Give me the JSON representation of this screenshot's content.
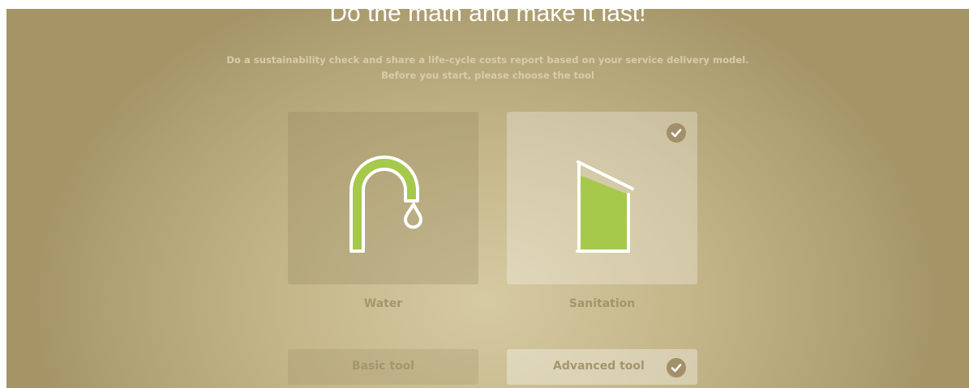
{
  "header": {
    "title": "Do the math and make it last!",
    "subtitle_line1": "Do a sustainability check and share a life-cycle costs report based on your service delivery model.",
    "subtitle_line2": "Before you start, please choose the tool"
  },
  "services": [
    {
      "label": "Water",
      "icon": "water-tap-icon",
      "selected": false
    },
    {
      "label": "Sanitation",
      "icon": "latrine-icon",
      "selected": true
    }
  ],
  "tools": [
    {
      "label": "Basic tool",
      "selected": false
    },
    {
      "label": "Advanced tool",
      "selected": true
    }
  ],
  "colors": {
    "accent_green": "#a6c94c",
    "check_badge": "#a3906a",
    "label_text": "#a3966c",
    "title_text": "#ffffff"
  }
}
